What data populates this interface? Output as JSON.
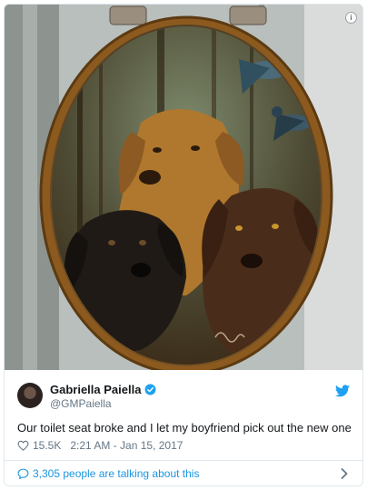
{
  "tweet": {
    "display_name": "Gabriella Paiella",
    "handle": "@GMPaiella",
    "text": "Our toilet seat broke and I let my boyfriend pick out the new one",
    "likes": "15.5K",
    "timestamp": "2:21 AM - Jan 15, 2017",
    "talking": "3,305 people are talking about this"
  },
  "icons": {
    "info": "i",
    "verified": "verified-badge-icon",
    "twitter": "twitter-bird-icon",
    "heart": "heart-icon",
    "reply": "speech-bubble-icon",
    "chevron": "chevron-right-icon"
  },
  "colors": {
    "link_blue": "#1b95e0",
    "verified_blue": "#1da1f2",
    "muted_text": "#657786",
    "main_text": "#14171a"
  }
}
